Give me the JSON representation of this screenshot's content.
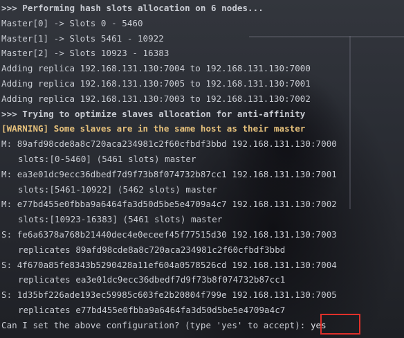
{
  "terminal": {
    "lines": [
      {
        "text": ">>> Performing hash slots allocation on 6 nodes...",
        "style": "bold"
      },
      {
        "text": "Master[0] -> Slots 0 - 5460",
        "style": "normal"
      },
      {
        "text": "Master[1] -> Slots 5461 - 10922",
        "style": "normal"
      },
      {
        "text": "Master[2] -> Slots 10923 - 16383",
        "style": "normal"
      },
      {
        "text": "Adding replica 192.168.131.130:7004 to 192.168.131.130:7000",
        "style": "normal"
      },
      {
        "text": "Adding replica 192.168.131.130:7005 to 192.168.131.130:7001",
        "style": "normal"
      },
      {
        "text": "Adding replica 192.168.131.130:7003 to 192.168.131.130:7002",
        "style": "normal"
      },
      {
        "text": ">>> Trying to optimize slaves allocation for anti-affinity",
        "style": "bold"
      },
      {
        "text": "[WARNING] Some slaves are in the same host as their master",
        "style": "warn"
      },
      {
        "text": "M: 89afd98cde8a8c720aca234981c2f60cfbdf3bbd 192.168.131.130:7000",
        "style": "normal"
      },
      {
        "text": "slots:[0-5460] (5461 slots) master",
        "style": "indent"
      },
      {
        "text": "M: ea3e01dc9ecc36dbedf7d9f73b8f074732b87cc1 192.168.131.130:7001",
        "style": "normal"
      },
      {
        "text": "slots:[5461-10922] (5462 slots) master",
        "style": "indent"
      },
      {
        "text": "M: e77bd455e0fbba9a6464fa3d50d5be5e4709a4c7 192.168.131.130:7002",
        "style": "normal"
      },
      {
        "text": "slots:[10923-16383] (5461 slots) master",
        "style": "indent"
      },
      {
        "text": "S: fe6a6378a768b21440dec4e0eceef45f77515d30 192.168.131.130:7003",
        "style": "normal"
      },
      {
        "text": "replicates 89afd98cde8a8c720aca234981c2f60cfbdf3bbd",
        "style": "indent"
      },
      {
        "text": "S: 4f670a85fe8343b5290428a11ef604a0578526cd 192.168.131.130:7004",
        "style": "normal"
      },
      {
        "text": "replicates ea3e01dc9ecc36dbedf7d9f73b8f074732b87cc1",
        "style": "indent"
      },
      {
        "text": "S: 1d35bf226ade193ec59985c603fe2b20804f799e 192.168.131.130:7005",
        "style": "normal"
      },
      {
        "text": "replicates e77bd455e0fbba9a6464fa3d50d5be5e4709a4c7",
        "style": "indent"
      }
    ],
    "prompt": "Can I set the above configuration? (type 'yes' to accept): ",
    "answer": "yes"
  },
  "colors": {
    "text": "#c9ccd3",
    "warning": "#e5c07b",
    "highlight_border": "#e0302a"
  }
}
